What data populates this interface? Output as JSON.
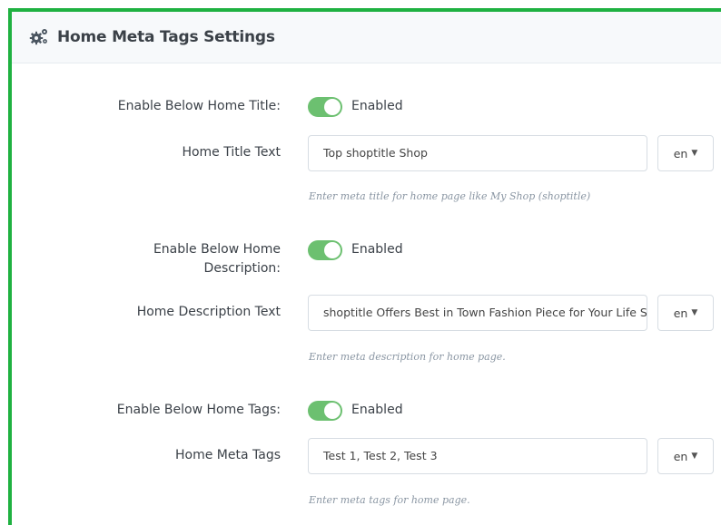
{
  "header": {
    "title": "Home Meta Tags Settings",
    "icon": "gears-icon"
  },
  "fields": {
    "title_toggle": {
      "label": "Enable Below Home Title:",
      "state": "Enabled"
    },
    "title_text": {
      "label": "Home Title Text",
      "value": "Top shoptitle Shop",
      "lang": "en",
      "help": "Enter meta title for home page like My Shop (shoptitle)"
    },
    "desc_toggle": {
      "label_line1": "Enable Below Home",
      "label_line2": "Description:",
      "state": "Enabled"
    },
    "desc_text": {
      "label": "Home Description Text",
      "value": "shoptitle Offers Best in Town Fashion Piece for Your Life St",
      "lang": "en",
      "help": "Enter meta description for home page."
    },
    "tags_toggle": {
      "label": "Enable Below Home Tags:",
      "state": "Enabled"
    },
    "tags_text": {
      "label": "Home Meta Tags",
      "value": "Test 1, Test 2, Test 3",
      "lang": "en",
      "help": "Enter meta tags for home page."
    }
  },
  "colors": {
    "frame": "#1fb141",
    "toggle_on": "#6cc070"
  }
}
